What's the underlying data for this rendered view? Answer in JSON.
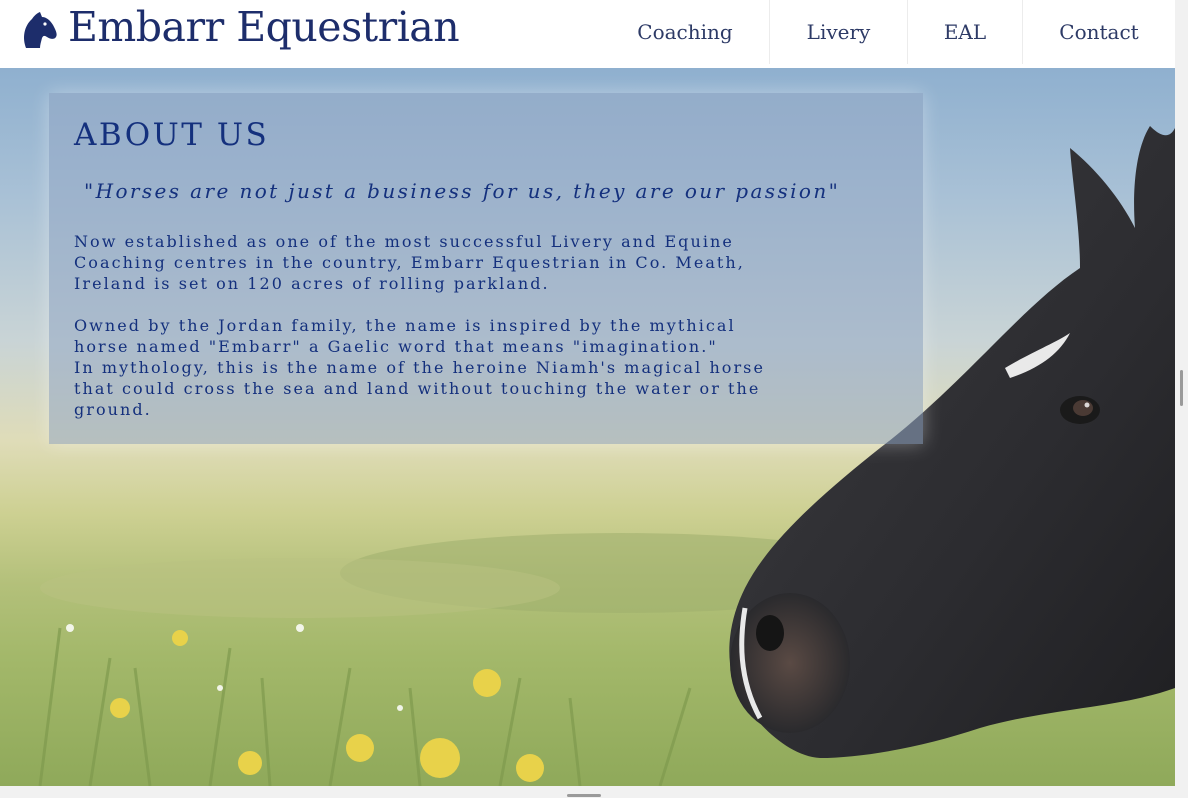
{
  "header": {
    "brand": "Embarr Equestrian",
    "logo_icon": "horse-head-icon",
    "brand_color": "#1d2d6b"
  },
  "nav": {
    "items": [
      {
        "label": "Coaching"
      },
      {
        "label": "Livery"
      },
      {
        "label": "EAL"
      },
      {
        "label": "Contact"
      }
    ]
  },
  "about": {
    "title": "ABOUT US",
    "quote": "\"Horses are not just a business for us, they are our passion\"",
    "paragraph1": "Now established as one of the most successful Livery and Equine\nCoaching centres in the country, Embarr Equestrian in Co. Meath,\nIreland is set on 120 acres of rolling parkland.",
    "paragraph2": "Owned by the Jordan family, the name is inspired by the mythical\nhorse named \"Embarr\" a Gaelic word that means \"imagination.\"\nIn mythology, this is the name of the heroine Niamh's magical horse\nthat could cross the sea and land without touching the water or the\nground.",
    "text_color": "#14307d"
  },
  "hero": {
    "image": "horse-in-meadow"
  }
}
